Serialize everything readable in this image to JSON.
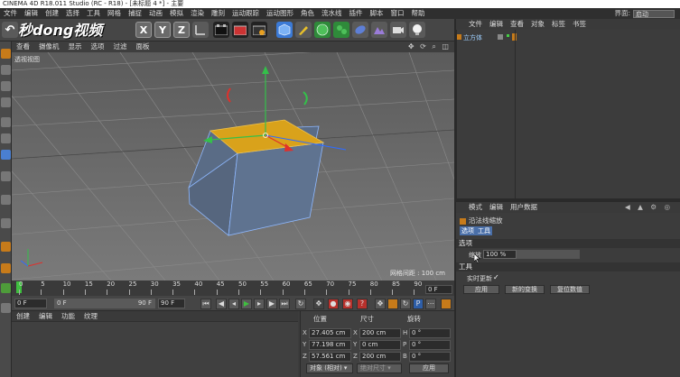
{
  "title_bar": {
    "text": "CINEMA 4D R18.011 Studio (RC - R18) - [未标题 4 *] - 主要"
  },
  "menu": {
    "items": [
      "文件",
      "编辑",
      "创建",
      "选择",
      "工具",
      "网格",
      "捕捉",
      "动画",
      "模拟",
      "渲染",
      "雕刻",
      "运动跟踪",
      "运动图形",
      "角色",
      "流水线",
      "插件",
      "脚本",
      "窗口",
      "帮助"
    ],
    "layout_label": "界面:",
    "layout_value": "启动"
  },
  "toolbar": {
    "axis_x": "X",
    "axis_y": "Y",
    "axis_z": "Z",
    "logo_text": "秒dong视频"
  },
  "viewport": {
    "menu": [
      "查看",
      "摄像机",
      "显示",
      "选项",
      "过滤",
      "面板"
    ],
    "label": "透视视图",
    "grid_spacing": "网格间距 : 100 cm",
    "nav_icons": "✥ ⟳ ⌕ ◫"
  },
  "timeline": {
    "ticks": [
      "0",
      "5",
      "10",
      "15",
      "20",
      "25",
      "30",
      "35",
      "40",
      "45",
      "50",
      "55",
      "60",
      "65",
      "70",
      "75",
      "80",
      "85",
      "90"
    ],
    "current_frame": "0 F"
  },
  "transport": {
    "start": "0 F",
    "range_start": "0 F",
    "range_end": "90 F",
    "end": "90 F"
  },
  "material": {
    "menu": [
      "创建",
      "编辑",
      "功能",
      "纹理"
    ]
  },
  "coords": {
    "position_header": "位置",
    "size_header": "尺寸",
    "rotation_header": "旋转",
    "rows": [
      {
        "axis": "X",
        "pos": "27.405 cm",
        "size": "200 cm",
        "rot_label": "H",
        "rot": "0 °"
      },
      {
        "axis": "Y",
        "pos": "77.198 cm",
        "size": "0 cm",
        "rot_label": "P",
        "rot": "0 °"
      },
      {
        "axis": "Z",
        "pos": "57.561 cm",
        "size": "200 cm",
        "rot_label": "B",
        "rot": "0 °"
      }
    ],
    "mode_select": "对象 (相对) ▾",
    "size_select": "绝对尺寸 ▾",
    "apply_button": "应用"
  },
  "object_manager": {
    "menu": [
      "文件",
      "编辑",
      "查看",
      "对象",
      "标签",
      "书签"
    ],
    "object_name": "立方体"
  },
  "attribute_manager": {
    "menu": [
      "模式",
      "编辑",
      "用户数据"
    ],
    "tool_name": "沿法线缩放",
    "tabs": [
      "选项",
      "工具"
    ],
    "options_header": "选项",
    "scale_label": "缩放",
    "scale_value": "100 %",
    "tool_header": "工具",
    "realtime_label": "实时更新",
    "realtime_check": "✓",
    "btn_apply": "应用",
    "btn_new": "新的变换",
    "btn_reset": "复位数值"
  },
  "colors": {
    "selected_face": "#d9a21b",
    "cube_side": "#5c6f8a",
    "axis_x": "#e0302b",
    "axis_y": "#34c04a",
    "axis_z": "#2f6cff"
  }
}
